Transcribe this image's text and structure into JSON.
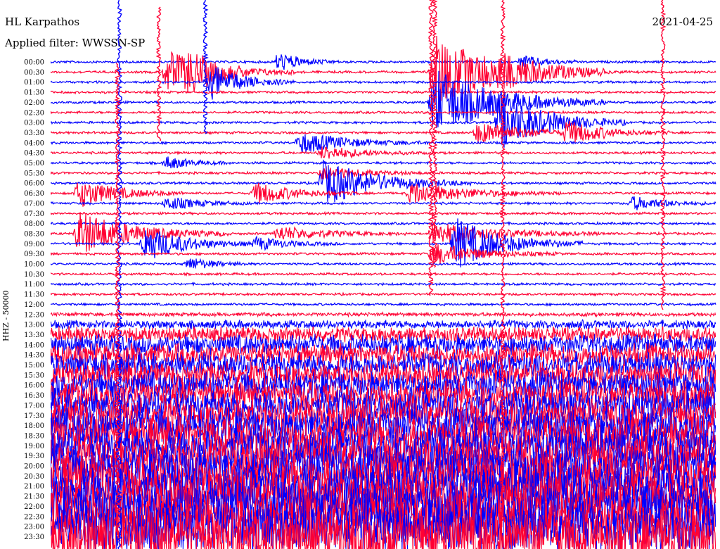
{
  "header": {
    "station": "HL Karpathos",
    "filter": "Applied filter: WWSSN-SP",
    "date": "2021-04-25"
  },
  "chart_data": {
    "type": "line",
    "title": "HL Karpathos",
    "subtitle": "Applied filter: WWSSN-SP",
    "date": "2021-04-25",
    "ylabel": "HHZ - 50000",
    "time_labels": [
      "00:00",
      "00:30",
      "01:00",
      "01:30",
      "02:00",
      "02:30",
      "03:00",
      "03:30",
      "04:00",
      "04:30",
      "05:00",
      "05:30",
      "06:00",
      "06:30",
      "07:00",
      "07:30",
      "08:00",
      "08:30",
      "09:00",
      "09:30",
      "10:00",
      "10:30",
      "11:00",
      "11:30",
      "12:00",
      "12:30",
      "13:00",
      "13:30",
      "14:00",
      "14:30",
      "15:00",
      "15:30",
      "16:00",
      "16:30",
      "17:00",
      "17:30",
      "18:00",
      "18:30",
      "19:00",
      "19:30",
      "20:00",
      "20:30",
      "21:00",
      "21:30",
      "22:00",
      "22:30",
      "23:00",
      "23:30"
    ],
    "trace_colors": [
      "#0000ff",
      "#ff0033"
    ],
    "events": [
      {
        "start": "00:30",
        "offset_min": 5,
        "duration_min": 6,
        "amplitude": 6
      },
      {
        "start": "00:30",
        "offset_min": 6,
        "duration_min": 3,
        "amplitude": 3
      },
      {
        "start": "01:00",
        "offset_min": 7,
        "duration_min": 4,
        "amplitude": 5
      },
      {
        "start": "00:00",
        "offset_min": 10,
        "duration_min": 3,
        "amplitude": 3
      },
      {
        "start": "00:30",
        "offset_min": 17,
        "duration_min": 8,
        "amplitude": 10
      },
      {
        "start": "00:00",
        "offset_min": 21,
        "duration_min": 3,
        "amplitude": 2
      },
      {
        "start": "00:30",
        "offset_min": 20,
        "duration_min": 6,
        "amplitude": 2
      },
      {
        "start": "03:30",
        "offset_min": 19,
        "duration_min": 6,
        "amplitude": 3
      },
      {
        "start": "04:00",
        "offset_min": 11,
        "duration_min": 6,
        "amplitude": 3
      },
      {
        "start": "04:30",
        "offset_min": 12,
        "duration_min": 5,
        "amplitude": 2
      },
      {
        "start": "05:00",
        "offset_min": 5,
        "duration_min": 3,
        "amplitude": 2
      },
      {
        "start": "05:30",
        "offset_min": 12,
        "duration_min": 5,
        "amplitude": 2
      },
      {
        "start": "06:00",
        "offset_min": 12,
        "duration_min": 7,
        "amplitude": 6
      },
      {
        "start": "06:30",
        "offset_min": 9,
        "duration_min": 5,
        "amplitude": 3
      },
      {
        "start": "06:30",
        "offset_min": 16,
        "duration_min": 7,
        "amplitude": 3
      },
      {
        "start": "06:30",
        "offset_min": 1,
        "duration_min": 5,
        "amplitude": 4
      },
      {
        "start": "07:00",
        "offset_min": 26,
        "duration_min": 4,
        "amplitude": 2
      },
      {
        "start": "07:00",
        "offset_min": 5,
        "duration_min": 4,
        "amplitude": 2
      },
      {
        "start": "08:30",
        "offset_min": 1,
        "duration_min": 7,
        "amplitude": 6
      },
      {
        "start": "08:30",
        "offset_min": 10,
        "duration_min": 6,
        "amplitude": 2
      },
      {
        "start": "08:30",
        "offset_min": 17,
        "duration_min": 8,
        "amplitude": 3
      },
      {
        "start": "09:00",
        "offset_min": 4,
        "duration_min": 5,
        "amplitude": 5
      },
      {
        "start": "09:00",
        "offset_min": 9,
        "duration_min": 4,
        "amplitude": 2
      },
      {
        "start": "09:00",
        "offset_min": 18,
        "duration_min": 6,
        "amplitude": 7
      },
      {
        "start": "09:30",
        "offset_min": 17,
        "duration_min": 6,
        "amplitude": 3
      },
      {
        "start": "10:00",
        "offset_min": 6,
        "duration_min": 3,
        "amplitude": 2
      },
      {
        "start": "03:00",
        "offset_min": 20,
        "duration_min": 6,
        "amplitude": 8
      },
      {
        "start": "03:30",
        "offset_min": 23,
        "duration_min": 5,
        "amplitude": 3
      },
      {
        "start": "02:00",
        "offset_min": 17,
        "duration_min": 8,
        "amplitude": 9
      }
    ]
  }
}
